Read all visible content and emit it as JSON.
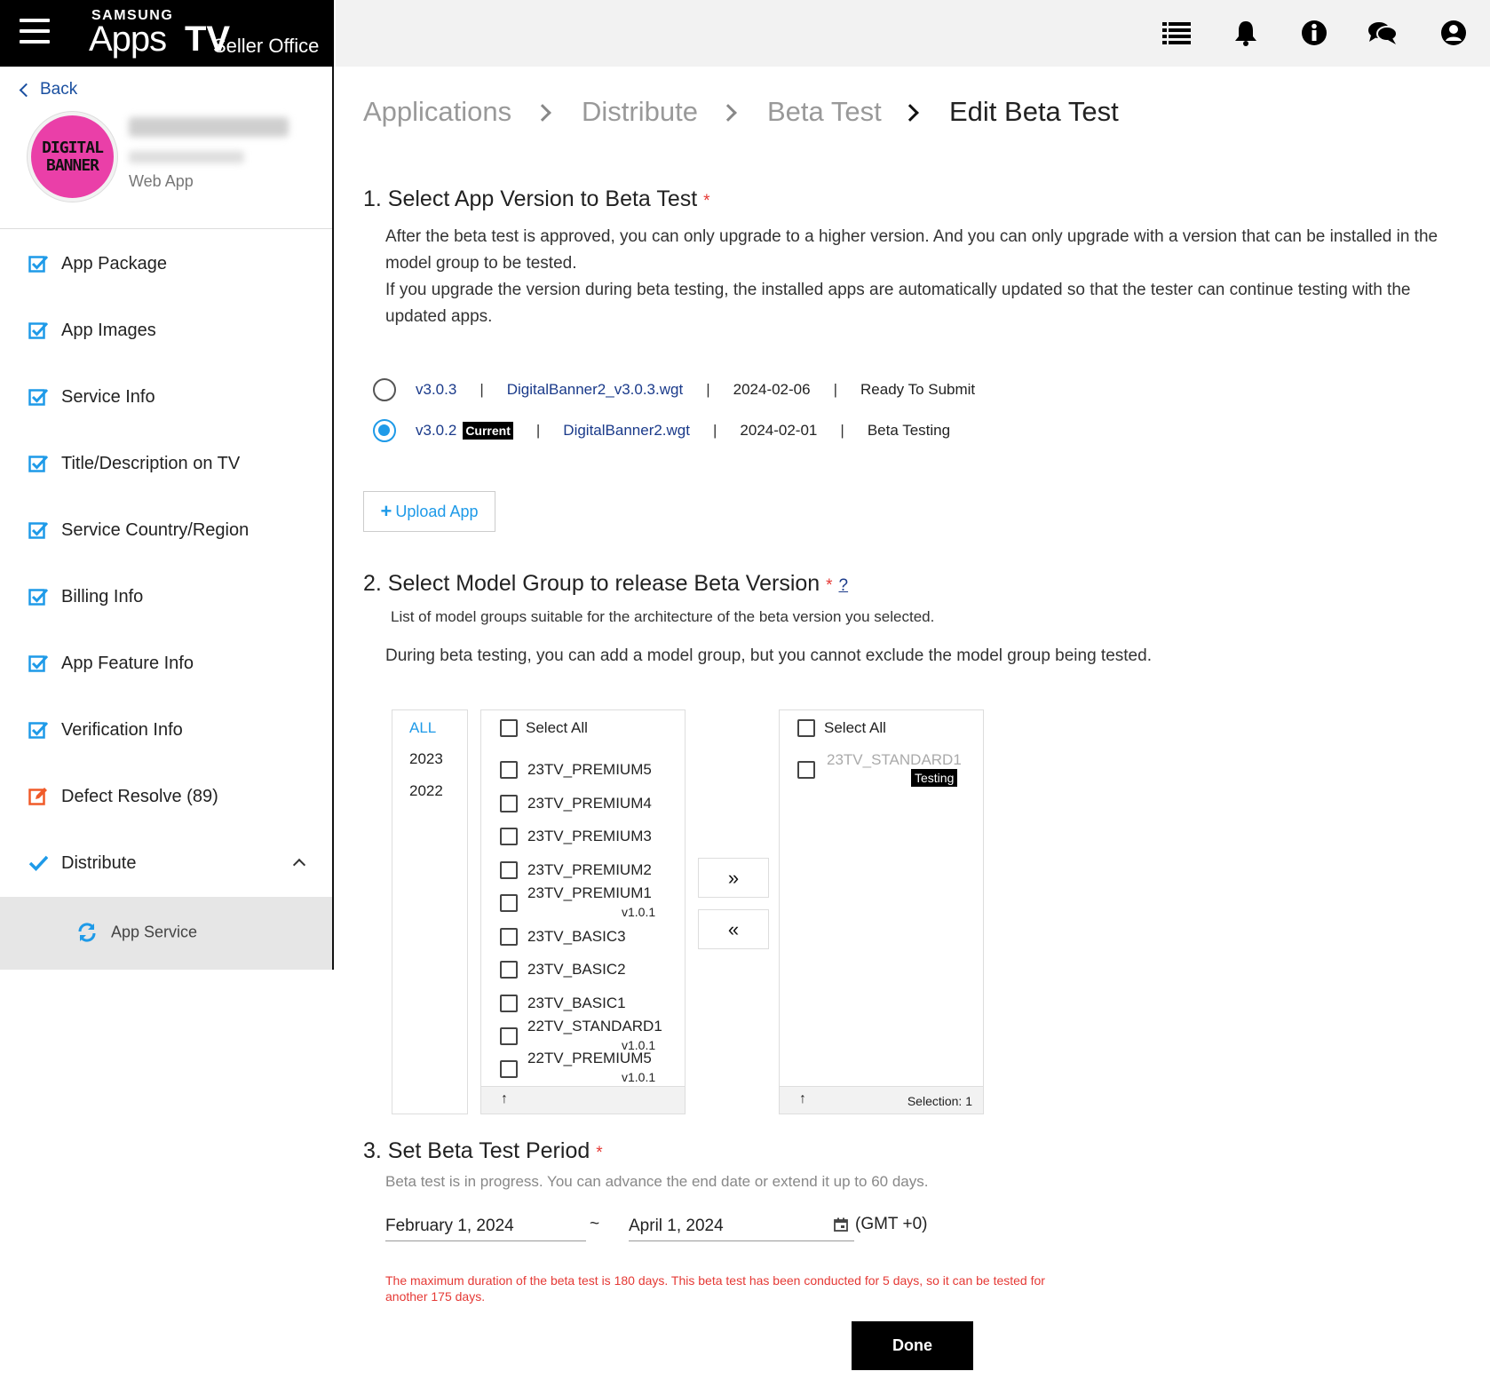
{
  "brand": {
    "samsung": "SAMSUNG",
    "apps": "Apps",
    "tv": "TV",
    "seller": "Seller Office"
  },
  "sidebar": {
    "back": "Back",
    "app_type": "Web App",
    "logo_line1": "DIGITAL",
    "logo_line2": "BANNER",
    "items": [
      {
        "label": "App Package",
        "icon": "checkbox-checked-icon"
      },
      {
        "label": "App Images",
        "icon": "checkbox-checked-icon"
      },
      {
        "label": "Service Info",
        "icon": "checkbox-checked-icon"
      },
      {
        "label": "Title/Description on TV",
        "icon": "checkbox-checked-icon"
      },
      {
        "label": "Service Country/Region",
        "icon": "checkbox-checked-icon"
      },
      {
        "label": "Billing Info",
        "icon": "checkbox-checked-icon"
      },
      {
        "label": "App Feature Info",
        "icon": "checkbox-checked-icon"
      },
      {
        "label": "Verification Info",
        "icon": "checkbox-checked-icon"
      },
      {
        "label": "Defect Resolve (89)",
        "icon": "edit-icon"
      },
      {
        "label": "Distribute",
        "icon": "check-icon"
      }
    ],
    "sub_item": {
      "label": "App Service",
      "icon": "refresh-icon"
    }
  },
  "topbar": {
    "icons": [
      "list-icon",
      "bell-icon",
      "info-icon",
      "chat-icon",
      "account-icon"
    ]
  },
  "breadcrumb": [
    "Applications",
    "Distribute",
    "Beta Test",
    "Edit Beta Test"
  ],
  "section1": {
    "title": "1. Select App Version to Beta Test",
    "required": "*",
    "desc1": "After the beta test is approved, you can only upgrade to a higher version. And you can only upgrade with a version that can be installed in the model group to be tested.",
    "desc2": "If you upgrade the version during beta testing, the installed apps are automatically updated so that the tester can continue testing with the updated apps.",
    "versions": [
      {
        "version": "v3.0.3",
        "badge": "",
        "file": "DigitalBanner2_v3.0.3.wgt",
        "date": "2024-02-06",
        "status": "Ready To Submit",
        "selected": false
      },
      {
        "version": "v3.0.2",
        "badge": "Current",
        "file": "DigitalBanner2.wgt",
        "date": "2024-02-01",
        "status": "Beta Testing",
        "selected": true
      }
    ],
    "separator": "|",
    "upload_label": "Upload App"
  },
  "section2": {
    "title": "2. Select Model Group to release Beta Version",
    "required": "*",
    "help": "?",
    "desc1": "List of model groups suitable for the architecture of the beta version you selected.",
    "desc2": "During beta testing, you can add a model group, but you cannot exclude the model group being tested.",
    "years": [
      "ALL",
      "2023",
      "2022"
    ],
    "select_all": "Select All",
    "available": [
      {
        "name": "23TV_PREMIUM5",
        "ver": ""
      },
      {
        "name": "23TV_PREMIUM4",
        "ver": ""
      },
      {
        "name": "23TV_PREMIUM3",
        "ver": ""
      },
      {
        "name": "23TV_PREMIUM2",
        "ver": ""
      },
      {
        "name": "23TV_PREMIUM1",
        "ver": "v1.0.1"
      },
      {
        "name": "23TV_BASIC3",
        "ver": ""
      },
      {
        "name": "23TV_BASIC2",
        "ver": ""
      },
      {
        "name": "23TV_BASIC1",
        "ver": ""
      },
      {
        "name": "22TV_STANDARD1",
        "ver": "v1.0.1"
      },
      {
        "name": "22TV_PREMIUM5",
        "ver": "v1.0.1"
      }
    ],
    "selected": [
      {
        "name": "23TV_STANDARD1",
        "badge": "Testing"
      }
    ],
    "selection_count": "Selection: 1",
    "sort_icon": "↑",
    "add_label": "»",
    "remove_label": "«"
  },
  "section3": {
    "title": "3. Set Beta Test Period",
    "required": "*",
    "desc": "Beta test is in progress. You can advance the end date or extend it up to 60 days.",
    "start": "February 1, 2024",
    "tilde": "~",
    "end": "April 1, 2024",
    "timezone": "(GMT +0)",
    "error": "The maximum duration of the beta test is 180 days. This beta test has been conducted for 5 days, so it can be tested for another 175 days."
  },
  "done_label": "Done",
  "colors": {
    "accent": "#1e9ae8",
    "link": "#1a3a8a",
    "error": "#e53935",
    "logo": "#ea3fa8"
  }
}
